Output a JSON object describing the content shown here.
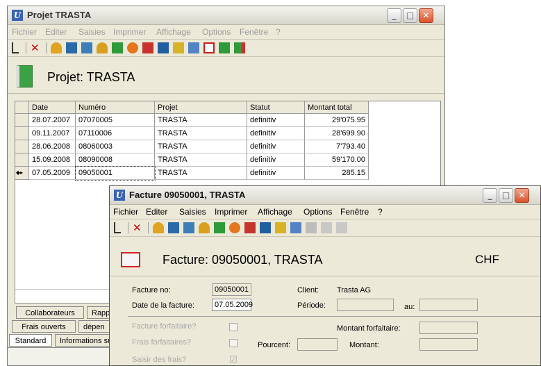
{
  "projet_window": {
    "title": "Projet TRASTA",
    "menu": [
      "Fichier",
      "Editer",
      "Saisies",
      "Imprimer",
      "Affichage",
      "Options",
      "Fenêtre",
      "?"
    ],
    "header_title": "Projet: TRASTA",
    "table": {
      "columns": [
        "Date",
        "Numéro",
        "Projet",
        "Statut",
        "Montant total"
      ],
      "rows": [
        [
          "28.07.2007",
          "07070005",
          "TRASTA",
          "definitiv",
          "29'075.95"
        ],
        [
          "09.11.2007",
          "07110006",
          "TRASTA",
          "definitiv",
          "28'699.90"
        ],
        [
          "28.06.2008",
          "08060003",
          "TRASTA",
          "definitiv",
          "7'793.40"
        ],
        [
          "15.09.2008",
          "08090008",
          "TRASTA",
          "definitiv",
          "59'170.00"
        ],
        [
          "07.05.2009",
          "09050001",
          "TRASTA",
          "definitiv",
          "285.15"
        ]
      ],
      "row_marker": "◆▸"
    },
    "tabs": {
      "row1": [
        "Collaborateurs",
        "Rapp"
      ],
      "row2": [
        "Frais ouverts",
        "dépen"
      ],
      "row3": [
        "Standard",
        "Informations su"
      ]
    }
  },
  "facture_window": {
    "title": "Facture 09050001, TRASTA",
    "menu": [
      "Fichier",
      "Editer",
      "Saisies",
      "Imprimer",
      "Affichage",
      "Options",
      "Fenêtre",
      "?"
    ],
    "header_title": "Facture: 09050001, TRASTA",
    "currency": "CHF",
    "form": {
      "facture_no_label": "Facture no:",
      "facture_no_value": "09050001",
      "client_label": "Client:",
      "client_value": "Trasta AG",
      "date_label": "Date de la facture:",
      "date_value": "07.05.2009",
      "periode_label": "Période:",
      "au_label": "au:",
      "forfaitaire_label": "Facture forfaitaire?",
      "montant_forfaitaire_label": "Montant forfaitaire:",
      "frais_forfaitaires_label": "Frais forfaitaires?",
      "pourcent_label": "Pourcent:",
      "montant_label": "Montant:",
      "saisir_frais_label": "Saisir des frais?",
      "saisir_frais_checked": "☑"
    }
  },
  "colors": {
    "window_bg": "#ece9d8",
    "grid_bg": "#ffffff",
    "close_button": "#d9542e"
  },
  "icons": {
    "window_controls": [
      "_",
      "□",
      "✕"
    ],
    "toolbar_close": "✕"
  }
}
